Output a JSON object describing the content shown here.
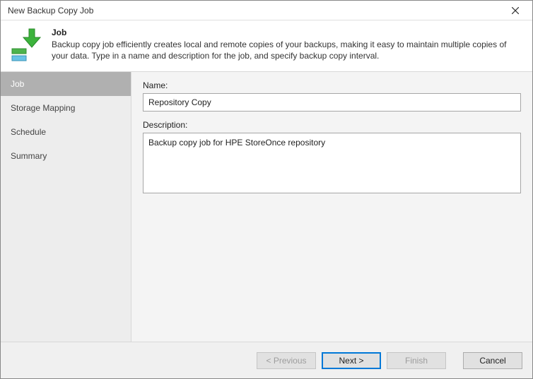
{
  "window": {
    "title": "New Backup Copy Job"
  },
  "header": {
    "title": "Job",
    "description": "Backup copy job efficiently creates local and remote copies of your backups, making it easy to maintain multiple copies of your data. Type in a name and description for the job, and specify backup copy interval."
  },
  "sidebar": {
    "items": [
      {
        "label": "Job"
      },
      {
        "label": "Storage Mapping"
      },
      {
        "label": "Schedule"
      },
      {
        "label": "Summary"
      }
    ]
  },
  "form": {
    "name_label": "Name:",
    "name_value": "Repository Copy",
    "description_label": "Description:",
    "description_value": "Backup copy job for HPE StoreOnce repository"
  },
  "footer": {
    "previous": "< Previous",
    "next": "Next >",
    "finish": "Finish",
    "cancel": "Cancel"
  }
}
